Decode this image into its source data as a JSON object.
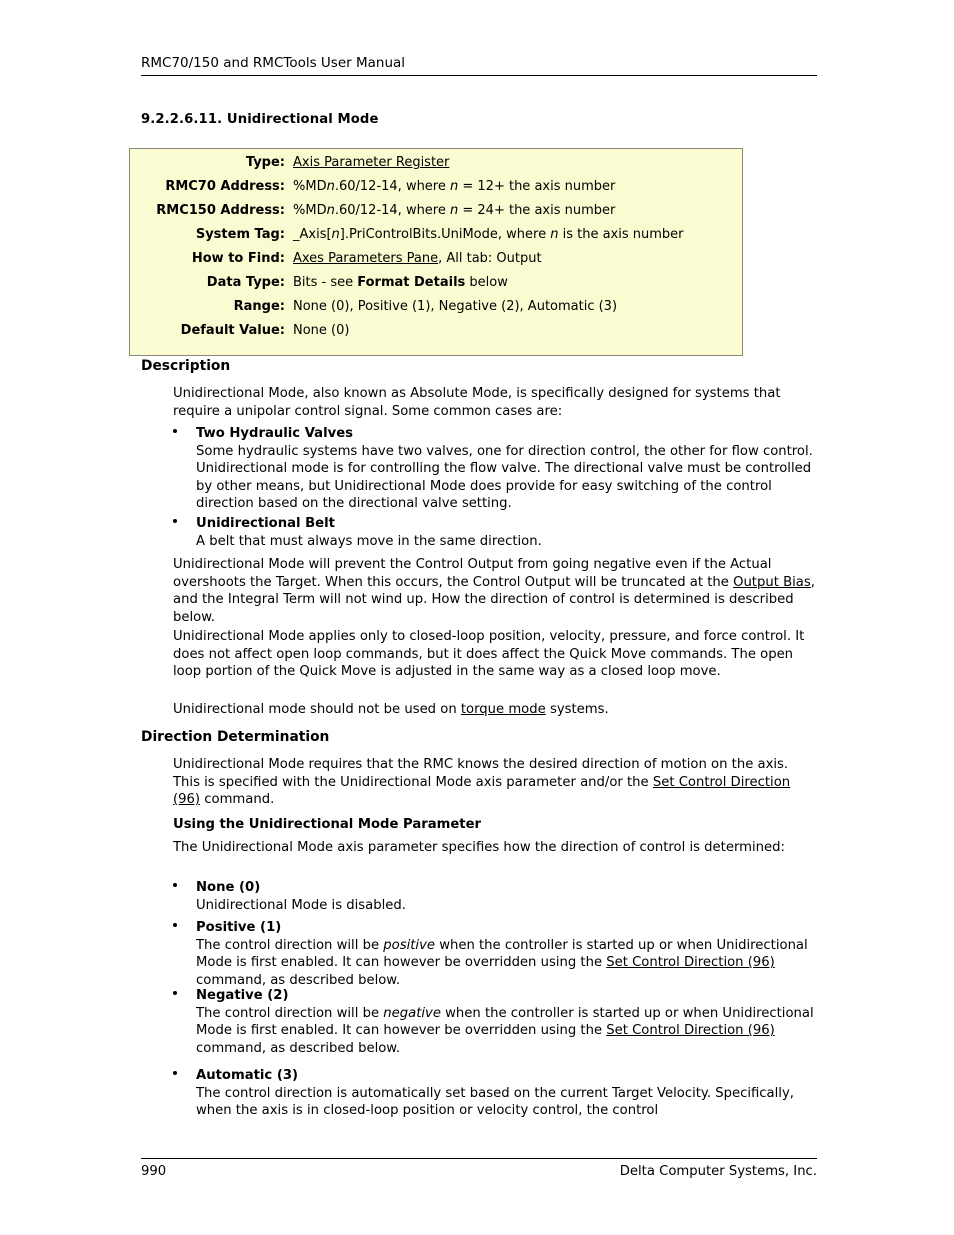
{
  "header": {
    "running_title": "RMC70/150 and RMCTools User Manual"
  },
  "section": {
    "number_and_title": "9.2.2.6.11. Unidirectional Mode"
  },
  "info_table": {
    "rows": [
      {
        "label": "Type:",
        "value_html": "<span class='lnk'>Axis Parameter Register</span>"
      },
      {
        "label": "RMC70 Address:",
        "value_html": "%MD<i>n</i>.60/12-14, where <i>n</i> = 12+ the axis number"
      },
      {
        "label": "RMC150 Address:",
        "value_html": "%MD<i>n</i>.60/12-14, where <i>n</i> = 24+ the axis number"
      },
      {
        "label": "System Tag:",
        "value_html": "_Axis[<i>n</i>].PriControlBits.UniMode, where <i>n</i> is the axis number"
      },
      {
        "label": "How to Find:",
        "value_html": "<span class='lnk'>Axes Parameters Pane</span>, All tab: Output"
      },
      {
        "label": "Data Type:",
        "value_html": "Bits - see <b>Format Details</b> below"
      },
      {
        "label": "Range:",
        "value_html": "None (0), Positive (1), Negative (2), Automatic (3)"
      },
      {
        "label": "Default Value:",
        "value_html": "None (0)"
      }
    ]
  },
  "description": {
    "heading": "Description",
    "intro_html": "Unidirectional Mode, also known as Absolute Mode, is specifically designed for systems that require a unipolar control signal. Some common cases are:",
    "bullets": [
      {
        "title": "Two Hydraulic Valves",
        "body_html": "Some hydraulic systems have two valves, one for direction control, the other for flow control. Unidirectional mode is for controlling the flow valve. The directional valve must be controlled by other means, but Unidirectional Mode does provide for easy switching of the control direction based on the directional valve setting."
      },
      {
        "title": "Unidirectional Belt",
        "body_html": "A belt that must always move in the same direction."
      }
    ],
    "para2_html": "Unidirectional Mode will prevent the Control Output from going negative even if the Actual overshoots the Target. When this occurs, the Control Output will be truncated at the <span class='lnk'>Output Bias</span>, and the Integral Term will not wind up. How the direction of control is determined is described below.",
    "para3_html": "Unidirectional Mode applies only to closed-loop position, velocity, pressure, and force control. It does not affect open loop commands, but it does affect the Quick Move commands. The open loop portion of the Quick Move is adjusted in the same way as a closed loop move.",
    "para4_html": "Unidirectional mode should not be used on <span class='lnk'>torque mode</span> systems."
  },
  "direction_determination": {
    "heading": "Direction Determination",
    "intro_html": "Unidirectional Mode requires that the RMC knows the desired direction of motion on the axis. This is specified with the Unidirectional Mode axis parameter and/or the <span class='lnk'>Set Control Direction (96)</span> command.",
    "subheading": "Using the Unidirectional Mode Parameter",
    "param_intro_html": "The Unidirectional Mode axis parameter specifies how the direction of control is determined:",
    "bullets": [
      {
        "title": "None (0)",
        "body_html": "Unidirectional Mode is disabled."
      },
      {
        "title": "Positive (1)",
        "body_html": "The control direction will be <i>positive</i> when the controller is started up or when Unidirectional Mode is first enabled. It can however be overridden using the <span class='lnk'>Set Control Direction (96)</span> command, as described below."
      },
      {
        "title": "Negative (2)",
        "body_html": "The control direction will be <i>negative</i> when the controller is started up or when Unidirectional Mode is first enabled. It can however be overridden using the <span class='lnk'>Set Control Direction (96)</span> command, as described below."
      },
      {
        "title": "Automatic (3)",
        "body_html": "The control direction is automatically set based on the current Target Velocity. Specifically, when the axis is in closed-loop position or velocity control, the control"
      }
    ]
  },
  "footer": {
    "page_number": "990",
    "company": "Delta Computer Systems, Inc."
  },
  "colors": {
    "table_background": "#FBFBD2",
    "table_border": "#8A8A78",
    "text": "#000000"
  }
}
